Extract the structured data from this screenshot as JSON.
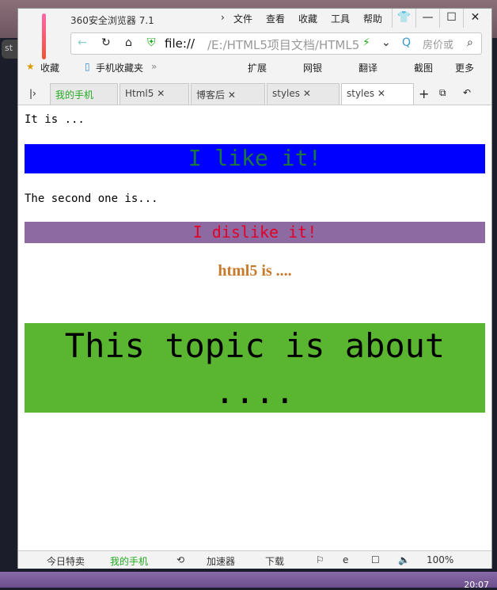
{
  "desktop": {
    "tab_text": "st",
    "clock": "20:07"
  },
  "browser": {
    "title": "360安全浏览器 7.1",
    "menu": [
      "文件",
      "查看",
      "收藏",
      "工具",
      "帮助"
    ],
    "address": {
      "scheme": "file://",
      "path": "/E:/HTML5项目文档/HTML5",
      "search_placeholder": "房价或"
    },
    "bookmarks": {
      "favorites": "收藏",
      "mobile_favorites": "手机收藏夹",
      "extensions": "扩展",
      "bank": "网银",
      "translate": "翻译",
      "screenshot": "截图",
      "more": "更多"
    },
    "tabs": [
      {
        "label": "我的手机"
      },
      {
        "label": "Html5"
      },
      {
        "label": "博客后"
      },
      {
        "label": "styles"
      },
      {
        "label": "styles",
        "active": true
      }
    ],
    "status": {
      "deals": "今日特卖",
      "my_phone": "我的手机",
      "accelerator": "加速器",
      "download": "下载",
      "zoom": "100%"
    }
  },
  "page": {
    "line1": "It is ...",
    "box1": {
      "text": "I like it!",
      "bg": "#0000ff",
      "color": "#1a7a3a"
    },
    "line2": "The second one is...",
    "box2": {
      "text": "I dislike it!",
      "bg": "#8e6aa3",
      "color": "#e0002a"
    },
    "html5": {
      "text": "html5 is ....",
      "color": "#c87a2a"
    },
    "box3": {
      "text": "This topic is about ....",
      "bg": "#5ab531",
      "color": "#000000"
    }
  }
}
